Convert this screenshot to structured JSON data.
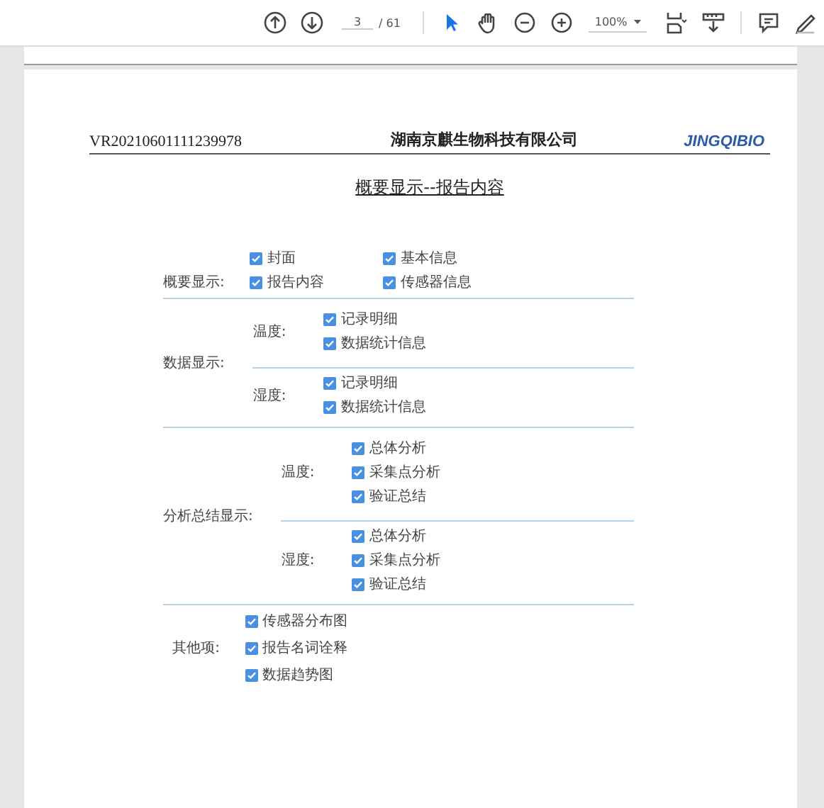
{
  "toolbar": {
    "page_current": "3",
    "page_total": "/ 61",
    "zoom": "100%"
  },
  "header": {
    "doc_id": "VR20210601111239978",
    "company": "湖南京麒生物科技有限公司",
    "logo": "JINGQIBIO"
  },
  "title": "概要显示--报告内容",
  "sections": [
    {
      "label": "概要显示:",
      "kind": "grid",
      "options": [
        {
          "label": "封面",
          "checked": true
        },
        {
          "label": "基本信息",
          "checked": true
        },
        {
          "label": "报告内容",
          "checked": true
        },
        {
          "label": "传感器信息",
          "checked": true
        }
      ]
    },
    {
      "label": "数据显示:",
      "kind": "groups",
      "groups": [
        {
          "label": "温度:",
          "options": [
            {
              "label": "记录明细",
              "checked": true
            },
            {
              "label": "数据统计信息",
              "checked": true
            }
          ]
        },
        {
          "label": "湿度:",
          "options": [
            {
              "label": "记录明细",
              "checked": true
            },
            {
              "label": "数据统计信息",
              "checked": true
            }
          ]
        }
      ]
    },
    {
      "label": "分析总结显示:",
      "kind": "groups",
      "groups": [
        {
          "label": "温度:",
          "options": [
            {
              "label": "总体分析",
              "checked": true
            },
            {
              "label": "采集点分析",
              "checked": true
            },
            {
              "label": "验证总结",
              "checked": true
            }
          ]
        },
        {
          "label": "湿度:",
          "options": [
            {
              "label": "总体分析",
              "checked": true
            },
            {
              "label": "采集点分析",
              "checked": true
            },
            {
              "label": "验证总结",
              "checked": true
            }
          ]
        }
      ]
    },
    {
      "label": "其他项:",
      "kind": "list",
      "options": [
        {
          "label": "传感器分布图",
          "checked": true
        },
        {
          "label": "报告名词诠释",
          "checked": true
        },
        {
          "label": "数据趋势图",
          "checked": true
        }
      ]
    }
  ]
}
